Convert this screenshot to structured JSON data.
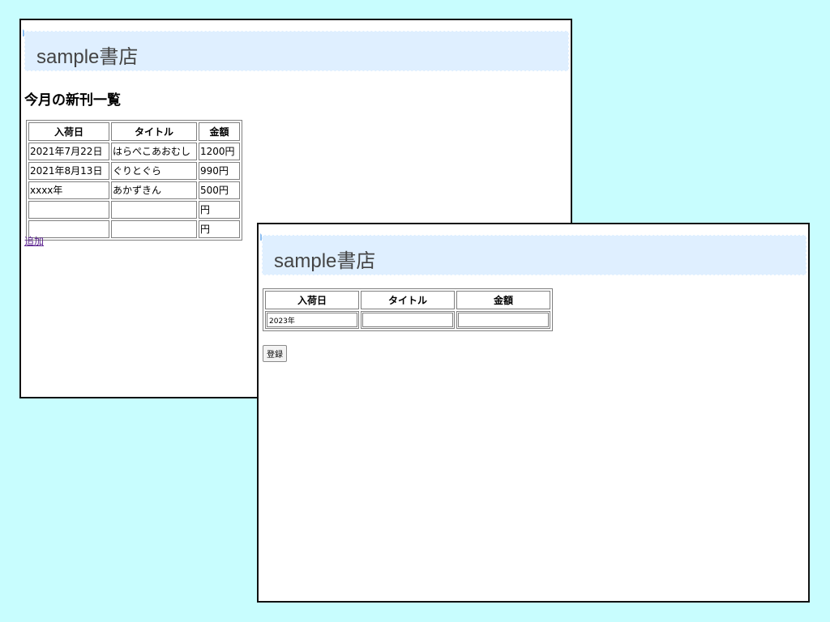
{
  "list_page": {
    "header_title": "sample書店",
    "section_title": "今月の新刊一覧",
    "table": {
      "headers": [
        "入荷日",
        "タイトル",
        "金額"
      ],
      "rows": [
        [
          "2021年7月22日",
          "はらぺこあおむし",
          "1200円"
        ],
        [
          "2021年8月13日",
          "ぐりとぐら",
          "990円"
        ],
        [
          "xxxx年",
          "あかずきん",
          "500円"
        ],
        [
          "",
          "",
          "円"
        ],
        [
          "",
          "",
          "円"
        ]
      ]
    },
    "add_link": "追加"
  },
  "form_page": {
    "header_title": "sample書店",
    "table": {
      "headers": [
        "入荷日",
        "タイトル",
        "金額"
      ],
      "inputs": {
        "date_value": "2023年",
        "title_value": "",
        "price_value": ""
      }
    },
    "register_button": "登録"
  },
  "colors": {
    "background": "#c8fdfe",
    "banner": "#dfefff",
    "banner_text": "#444444",
    "link_visited": "#551a8b"
  }
}
